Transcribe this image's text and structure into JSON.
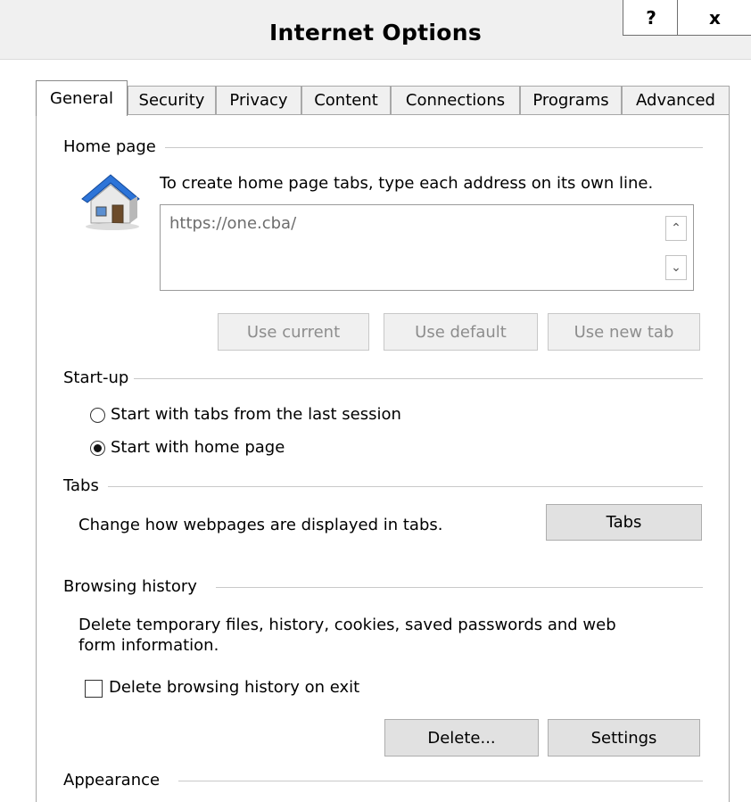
{
  "window": {
    "title": "Internet Options",
    "help_label": "?",
    "close_label": "x"
  },
  "tabs": [
    {
      "label": "General",
      "active": true
    },
    {
      "label": "Security"
    },
    {
      "label": "Privacy"
    },
    {
      "label": "Content"
    },
    {
      "label": "Connections"
    },
    {
      "label": "Programs"
    },
    {
      "label": "Advanced"
    }
  ],
  "home_page": {
    "section_label": "Home page",
    "instruction": "To create home page tabs, type each address on its own line.",
    "address_value": "https://one.cba/",
    "use_current_label": "Use current",
    "use_default_label": "Use default",
    "use_new_tab_label": "Use new tab"
  },
  "startup": {
    "section_label": "Start-up",
    "option_last_session": "Start with tabs from the last session",
    "option_home_page": "Start with home page",
    "selected": "Start with home page"
  },
  "tabs_section": {
    "section_label": "Tabs",
    "description": "Change how webpages are displayed in tabs.",
    "button_label": "Tabs"
  },
  "browsing_history": {
    "section_label": "Browsing history",
    "description_line1": "Delete temporary files, history, cookies, saved passwords and web",
    "description_line2": "form information.",
    "delete_on_exit_label": "Delete browsing history on exit",
    "delete_on_exit_checked": false,
    "delete_button_label": "Delete...",
    "settings_button_label": "Settings"
  },
  "appearance": {
    "section_label": "Appearance"
  }
}
